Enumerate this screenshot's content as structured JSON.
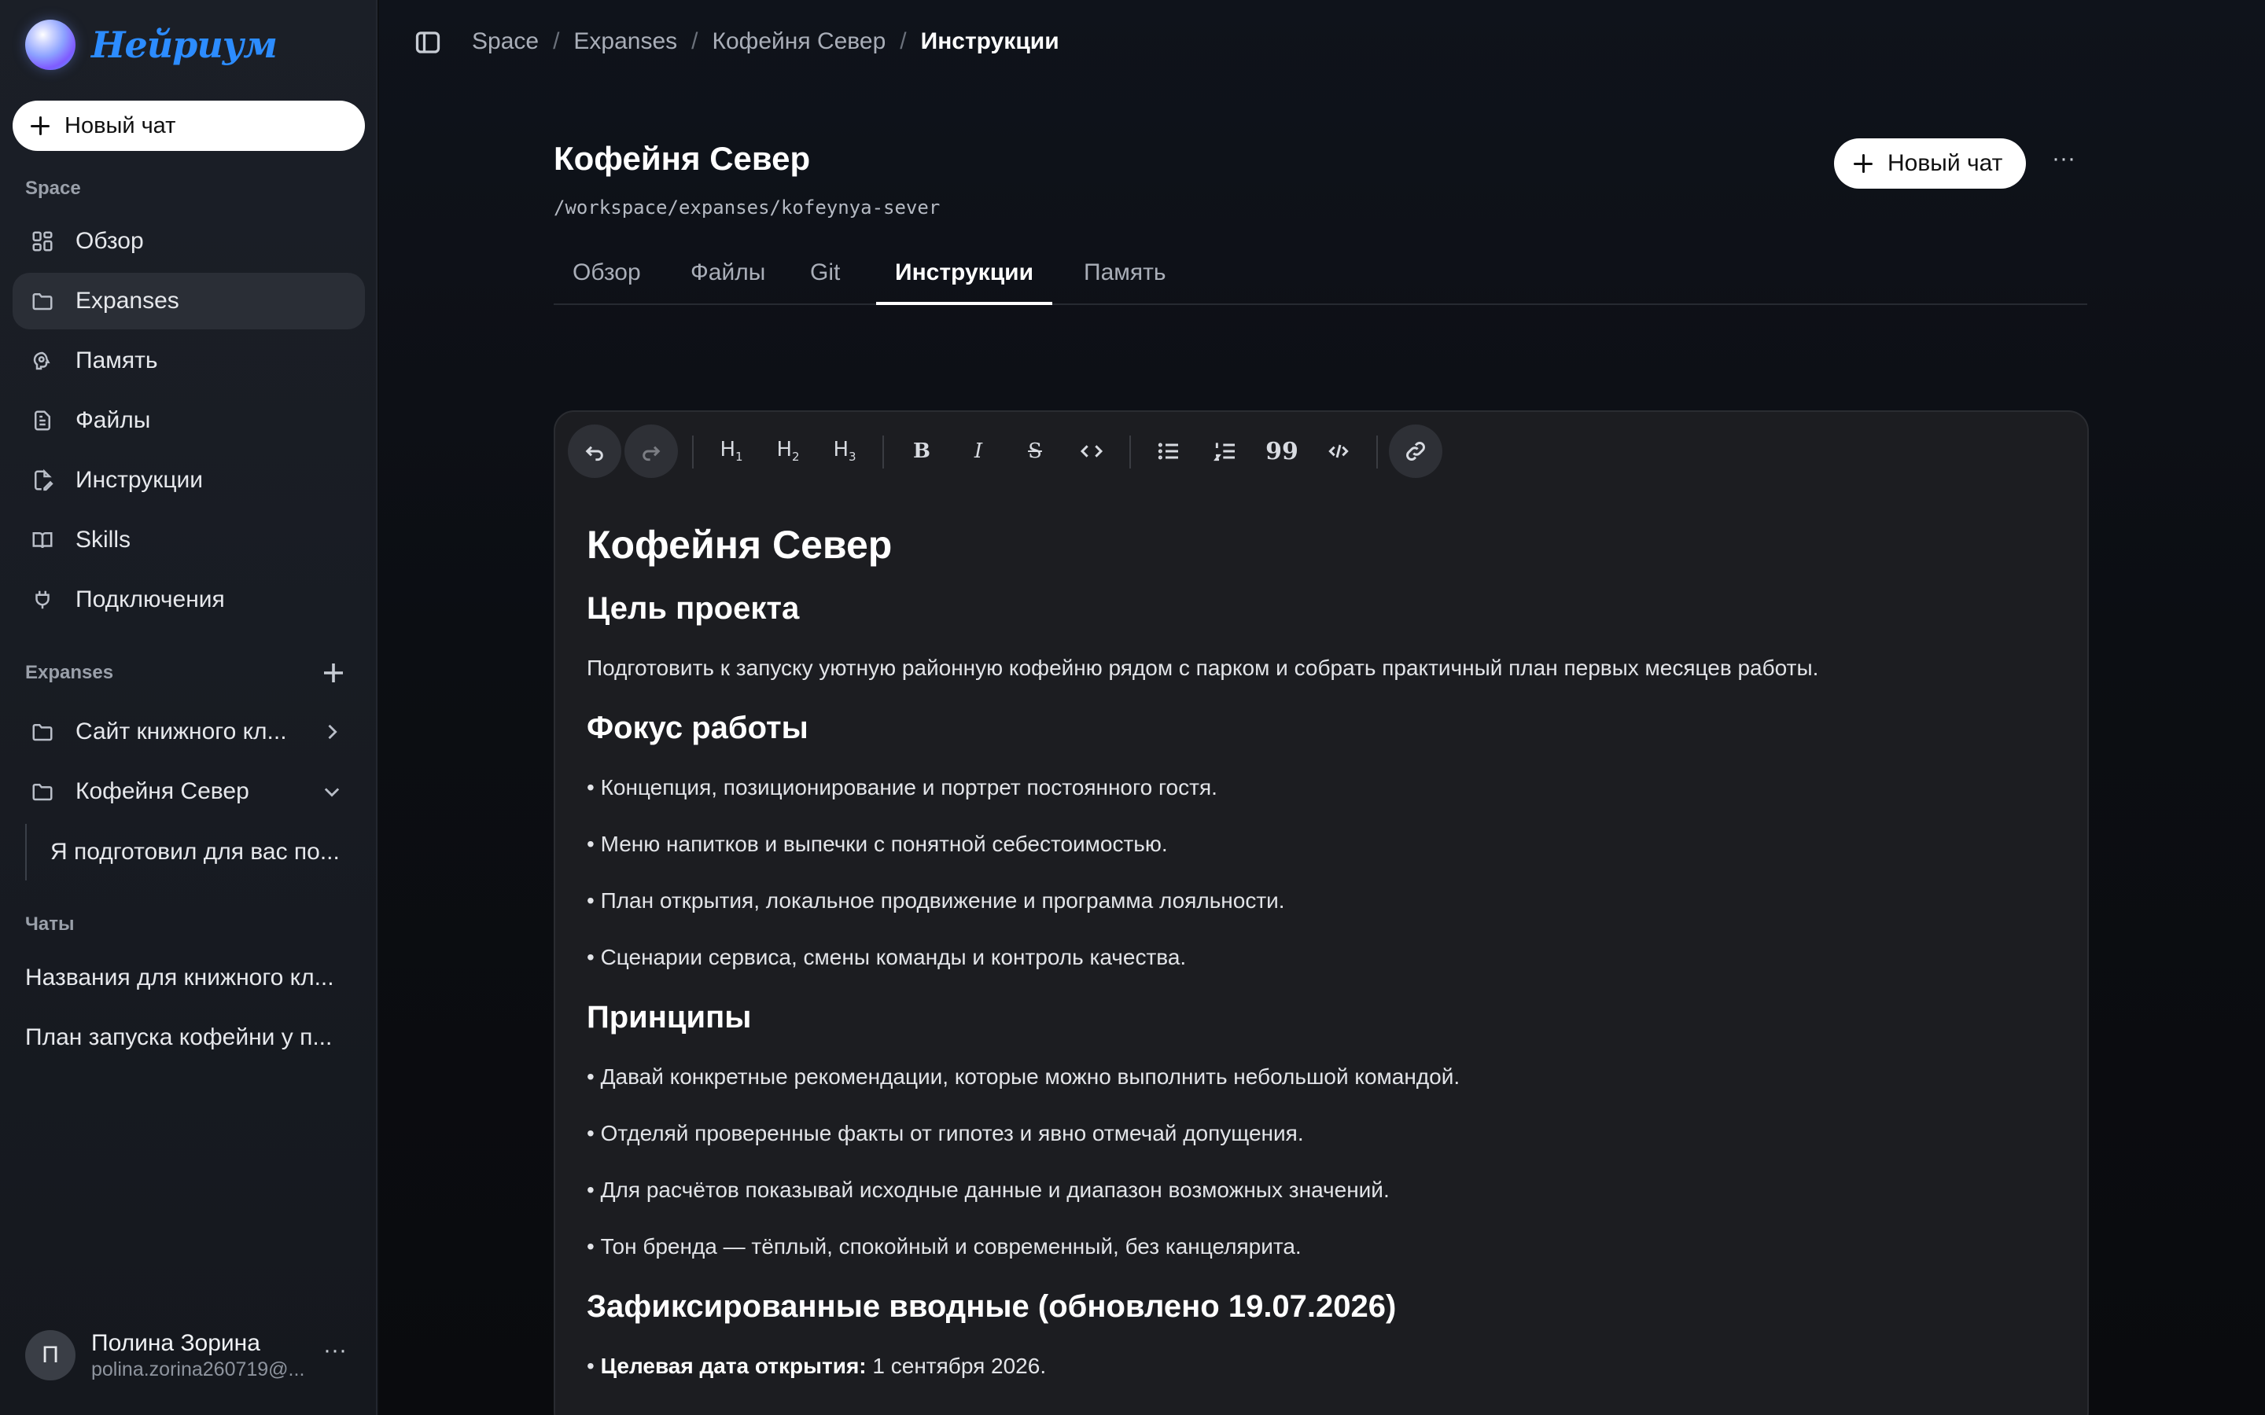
{
  "brand": {
    "name": "Нейриум",
    "icon": "brand-orb-icon"
  },
  "sidebar": {
    "new_chat_label": "Новый чат",
    "space_label": "Space",
    "nav": [
      {
        "label": "Обзор",
        "icon": "grid-icon"
      },
      {
        "label": "Expanses",
        "icon": "folder-icon"
      },
      {
        "label": "Память",
        "icon": "brain-icon"
      },
      {
        "label": "Файлы",
        "icon": "file-icon"
      },
      {
        "label": "Инструкции",
        "icon": "file-edit-icon"
      },
      {
        "label": "Skills",
        "icon": "book-icon"
      },
      {
        "label": "Подключения",
        "icon": "plug-icon"
      }
    ],
    "expanses_label": "Expanses",
    "expanses": [
      {
        "label": "Сайт книжного кл..."
      },
      {
        "label": "Кофейня Север"
      }
    ],
    "expanse_sub": "Я подготовил для вас по...",
    "chats_label": "Чаты",
    "chats": [
      {
        "label": "Названия для книжного кл..."
      },
      {
        "label": "План запуска кофейни у п..."
      }
    ],
    "user": {
      "initial": "П",
      "name": "Полина Зорина",
      "email": "polina.zorina260719@...",
      "more": "···"
    }
  },
  "header": {
    "breadcrumb": [
      "Space",
      "Expanses",
      "Кофейня Север",
      "Инструкции"
    ],
    "separator": "/"
  },
  "project": {
    "title": "Кофейня Север",
    "path": "/workspace/expanses/kofeynya-sever",
    "new_chat_label": "Новый чат",
    "more": "···"
  },
  "tabs": [
    "Обзор",
    "Файлы",
    "Git",
    "Инструкции",
    "Память"
  ],
  "active_tab": "Инструкции",
  "toolbar": {
    "h1": "H",
    "h2": "H",
    "h3": "H",
    "bold": "B",
    "italic": "I",
    "strike": "S",
    "quote": "99"
  },
  "doc": {
    "title": "Кофейня Север",
    "goal_heading": "Цель проекта",
    "goal_text": "Подготовить к запуску уютную районную кофейню рядом с парком и собрать практичный план первых месяцев работы.",
    "focus_heading": "Фокус работы",
    "focus_items": [
      "• Концепция, позиционирование и портрет постоянного гостя.",
      "• Меню напитков и выпечки с понятной себестоимостью.",
      "• План открытия, локальное продвижение и программа лояльности.",
      "• Сценарии сервиса, смены команды и контроль качества."
    ],
    "principles_heading": "Принципы",
    "principles_items": [
      "• Давай конкретные рекомендации, которые можно выполнить небольшой командой.",
      "• Отделяй проверенные факты от гипотез и явно отмечай допущения.",
      "• Для расчётов показывай исходные данные и диапазон возможных значений.",
      "• Тон бренда — тёплый, спокойный и современный, без канцелярита."
    ],
    "inputs_heading": "Зафиксированные вводные (обновлено 19.07.2026)",
    "opening_bullet": "•",
    "opening_label": "Целевая дата открытия:",
    "opening_value": "1 сентября 2026."
  }
}
